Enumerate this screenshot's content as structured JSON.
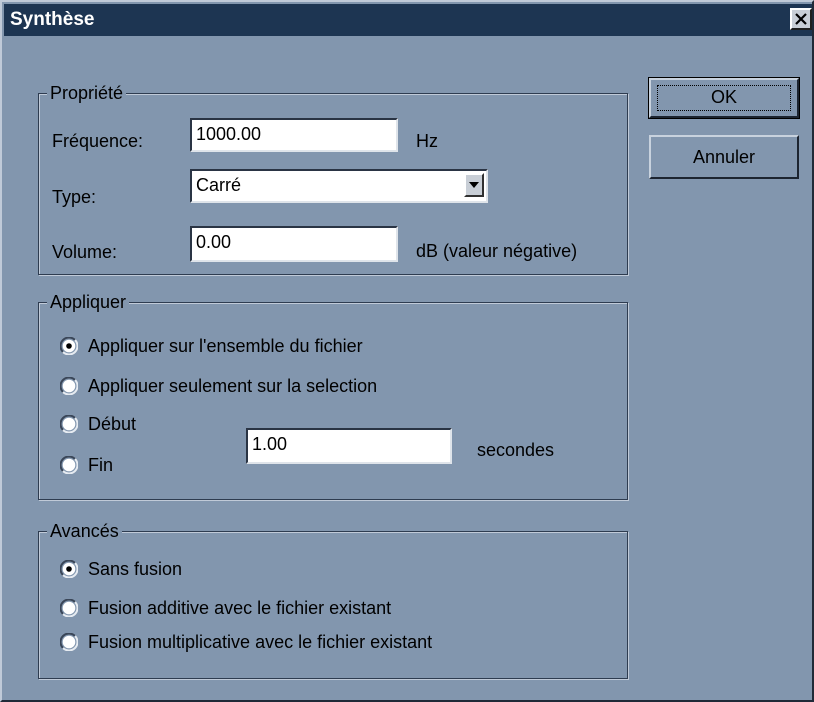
{
  "window": {
    "title": "Synthèse"
  },
  "buttons": {
    "ok": "OK",
    "cancel": "Annuler"
  },
  "propriete": {
    "legend": "Propriété",
    "frequency_label": "Fréquence:",
    "frequency_value": "1000.00",
    "frequency_unit": "Hz",
    "type_label": "Type:",
    "type_value": "Carré",
    "volume_label": "Volume:",
    "volume_value": "0.00",
    "volume_unit": "dB (valeur négative)"
  },
  "appliquer": {
    "legend": "Appliquer",
    "options": [
      {
        "label": "Appliquer sur l'ensemble du fichier",
        "selected": true
      },
      {
        "label": "Appliquer seulement sur la selection",
        "selected": false
      },
      {
        "label": "Début",
        "selected": false
      },
      {
        "label": "Fin",
        "selected": false
      }
    ],
    "duration_value": "1.00",
    "duration_unit": "secondes"
  },
  "avances": {
    "legend": "Avancés",
    "options": [
      {
        "label": "Sans fusion",
        "selected": true
      },
      {
        "label": "Fusion additive avec le fichier existant",
        "selected": false
      },
      {
        "label": "Fusion multiplicative avec le fichier existant",
        "selected": false
      }
    ]
  },
  "colors": {
    "dialog_background": "#8296ae",
    "titlebar_background": "#1d3552",
    "titlebar_text": "#ffffff"
  },
  "icons": {
    "close": "close-icon",
    "dropdown": "chevron-down-icon",
    "radio": "radio-icon"
  }
}
